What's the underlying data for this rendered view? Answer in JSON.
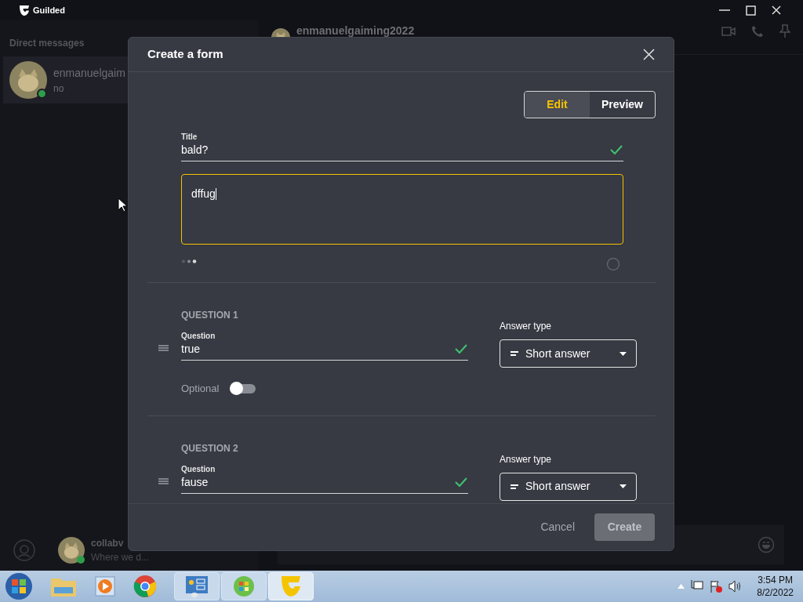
{
  "app": {
    "title": "Guilded"
  },
  "sidebar": {
    "heading": "Direct messages",
    "conversations": [
      {
        "name": "enmanuelgaim",
        "preview": "no",
        "selected": true
      }
    ],
    "footer": {
      "name": "collabv",
      "status": "Where we d..."
    }
  },
  "chat": {
    "title": "enmanuelgaiming2022"
  },
  "modal": {
    "title": "Create a form",
    "mode_tabs": [
      {
        "label": "Edit",
        "selected": true
      },
      {
        "label": "Preview",
        "selected": false
      }
    ],
    "title_field": {
      "label": "Title",
      "value": "bald?",
      "valid": true
    },
    "description": {
      "value": "dffug",
      "focused": true
    },
    "questions": [
      {
        "heading": "QUESTION 1",
        "label": "Question",
        "value": "true",
        "valid": true,
        "answer_type_label": "Answer type",
        "answer_type": "Short answer",
        "optional_label": "Optional",
        "optional": false
      },
      {
        "heading": "QUESTION 2",
        "label": "Question",
        "value": "fause",
        "valid": true,
        "answer_type_label": "Answer type",
        "answer_type": "Short answer"
      }
    ],
    "cancel": "Cancel",
    "create": {
      "label": "Create",
      "disabled": true
    }
  },
  "taskbar": {
    "time": "3:54 PM",
    "date": "8/2/2022"
  }
}
